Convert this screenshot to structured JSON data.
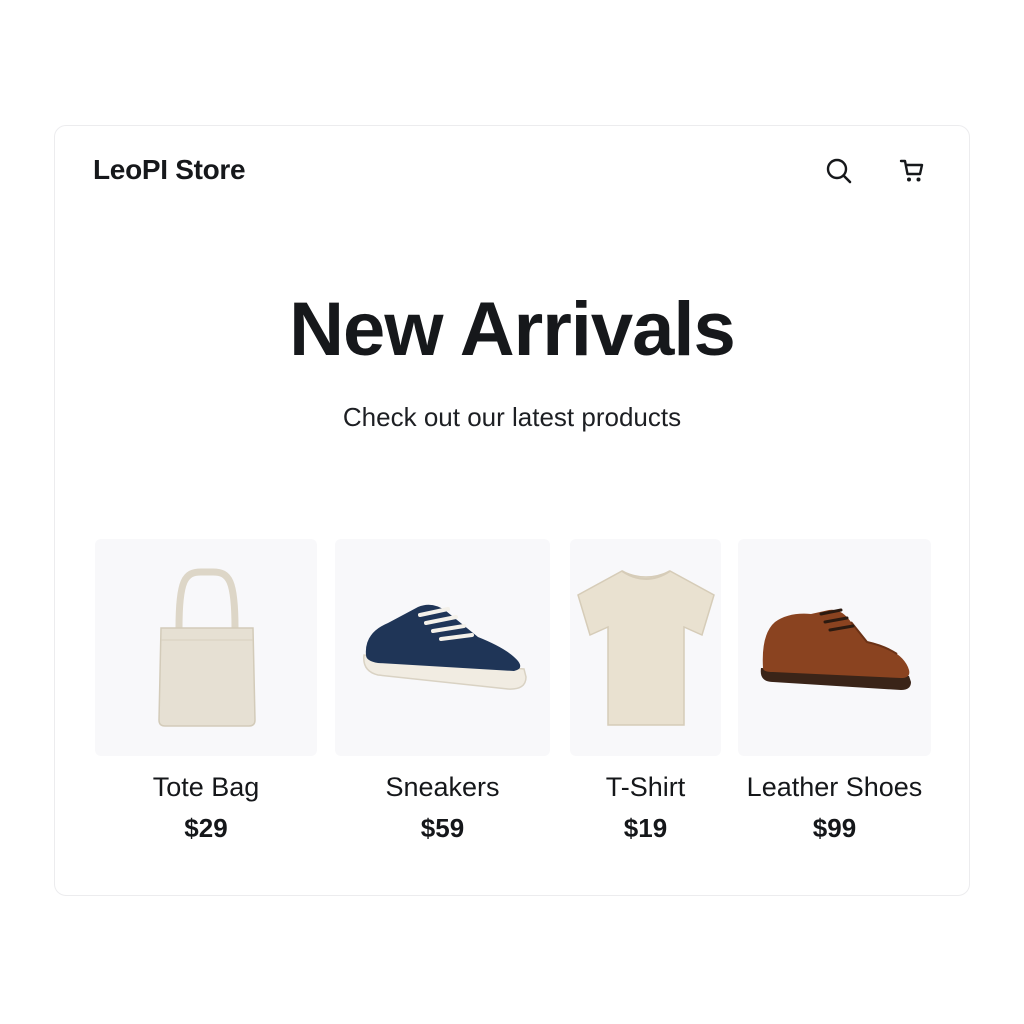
{
  "header": {
    "brand": "LeoPI Store",
    "icons": [
      "search-icon",
      "cart-icon"
    ]
  },
  "hero": {
    "title": "New Arrivals",
    "subtitle": "Check out our latest products"
  },
  "products": [
    {
      "name": "Tote Bag",
      "price": "$29",
      "image": "tote-bag-image",
      "color": "#e6e0d3"
    },
    {
      "name": "Sneakers",
      "price": "$59",
      "image": "sneakers-image",
      "color": "#1f3557"
    },
    {
      "name": "T-Shirt",
      "price": "$19",
      "image": "tshirt-image",
      "color": "#e9e1d0"
    },
    {
      "name": "Leather Shoes",
      "price": "$99",
      "image": "leather-shoes-image",
      "color": "#8a4320"
    }
  ],
  "colors": {
    "text": "#16181b",
    "border": "#ececee",
    "thumb_bg": "#f8f8fa"
  }
}
